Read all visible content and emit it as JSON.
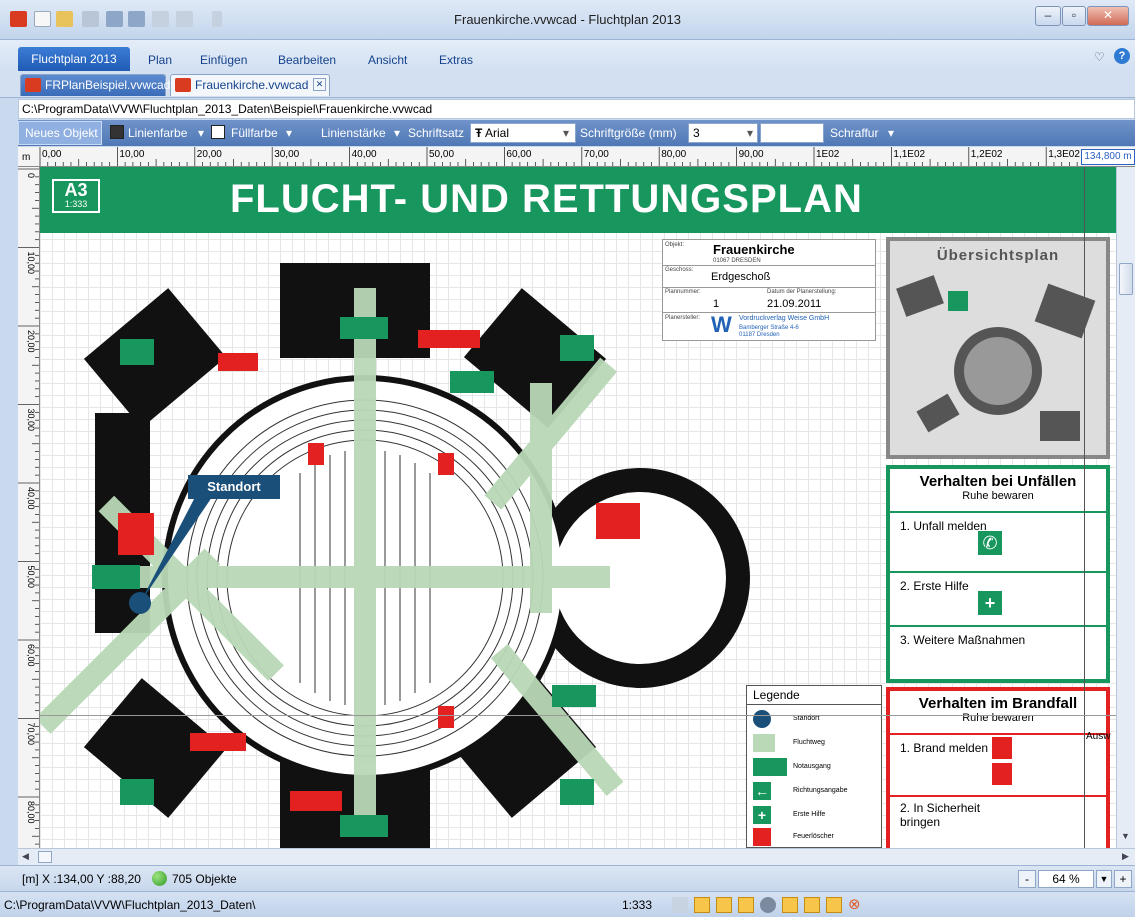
{
  "window": {
    "title": "Frauenkirche.vvwcad - Fluchtplan 2013"
  },
  "ribbon": {
    "file_label": "Fluchtplan 2013",
    "items": [
      "Plan",
      "Einfügen",
      "Bearbeiten",
      "Ansicht",
      "Extras"
    ]
  },
  "tabs": [
    {
      "label": "FRPlanBeispiel.vvwcad"
    },
    {
      "label": "Frauenkirche.vvwcad"
    }
  ],
  "path": "C:\\ProgramData\\VVW\\Fluchtplan_2013_Daten\\Beispiel\\Frauenkirche.vvwcad",
  "toolbar": {
    "new_object": "Neues Objekt",
    "line_color": "Linienfarbe",
    "fill_color": "Füllfarbe",
    "line_width": "Linienstärke",
    "font": "Schriftsatz",
    "font_value": "Arial",
    "font_size_label": "Schriftgröße (mm)",
    "font_size_value": "3",
    "hatch": "Schraffur"
  },
  "ruler": {
    "unit": "m",
    "top_ticks": [
      "0,00",
      "10,00",
      "20,00",
      "30,00",
      "40,00",
      "50,00",
      "60,00",
      "70,00",
      "80,00",
      "90,00",
      "1E02",
      "1,1E02",
      "1,2E02",
      "1,3E02"
    ],
    "top_readout": "134,800 m",
    "left_ticks": [
      "0",
      "10,00",
      "20,00",
      "30,00",
      "40,00",
      "50,00",
      "60,00",
      "70,00",
      "80,00"
    ]
  },
  "plan": {
    "title": "FLUCHT- UND RETTUNGSPLAN",
    "format": "A3",
    "scale": "1:333",
    "location_label": "Standort",
    "info": {
      "objekt_label": "Objekt:",
      "objekt": "Frauenkirche",
      "objekt_sub": "01067 DRESDEN",
      "geschoss_label": "Geschoss:",
      "geschoss": "Erdgeschoß",
      "plannr_label": "Plannummer:",
      "plannr": "1",
      "datum_label": "Datum der Planerstellung:",
      "datum": "21.09.2011",
      "ersteller_label": "Planersteller:",
      "ersteller": "Vordruckverlag Weise GmbH",
      "ersteller_addr1": "Bamberger Straße 4-6",
      "ersteller_addr2": "01187 Dresden"
    },
    "overview_title": "Übersichtsplan",
    "unfall": {
      "title": "Verhalten bei Unfällen",
      "subtitle": "Ruhe bewaren",
      "steps": [
        "1. Unfall melden",
        "2. Erste Hilfe",
        "3. Weitere Maßnahmen"
      ]
    },
    "brand": {
      "title": "Verhalten im Brandfall",
      "subtitle": "Ruhe bewaren",
      "steps": [
        "1. Brand melden",
        "2. In Sicherheit",
        "bringen"
      ],
      "side_label": "Ausw"
    },
    "legend": {
      "title": "Legende",
      "items": [
        "Standort",
        "Fluchtweg",
        "Notausgang",
        "Richtungsangabe",
        "Erste Hilfe",
        "Feuerlöscher"
      ]
    }
  },
  "status": {
    "coords": "[m] X :134,00 Y :88,20",
    "objects": "705 Objekte",
    "zoom": "64 %",
    "path": "C:\\ProgramData\\VVW\\Fluchtplan_2013_Daten\\",
    "scale": "1:333"
  },
  "colors": {
    "green": "#17965d",
    "red": "#e42121",
    "navy": "#1a4f7a",
    "route": "#b9d9b7"
  }
}
